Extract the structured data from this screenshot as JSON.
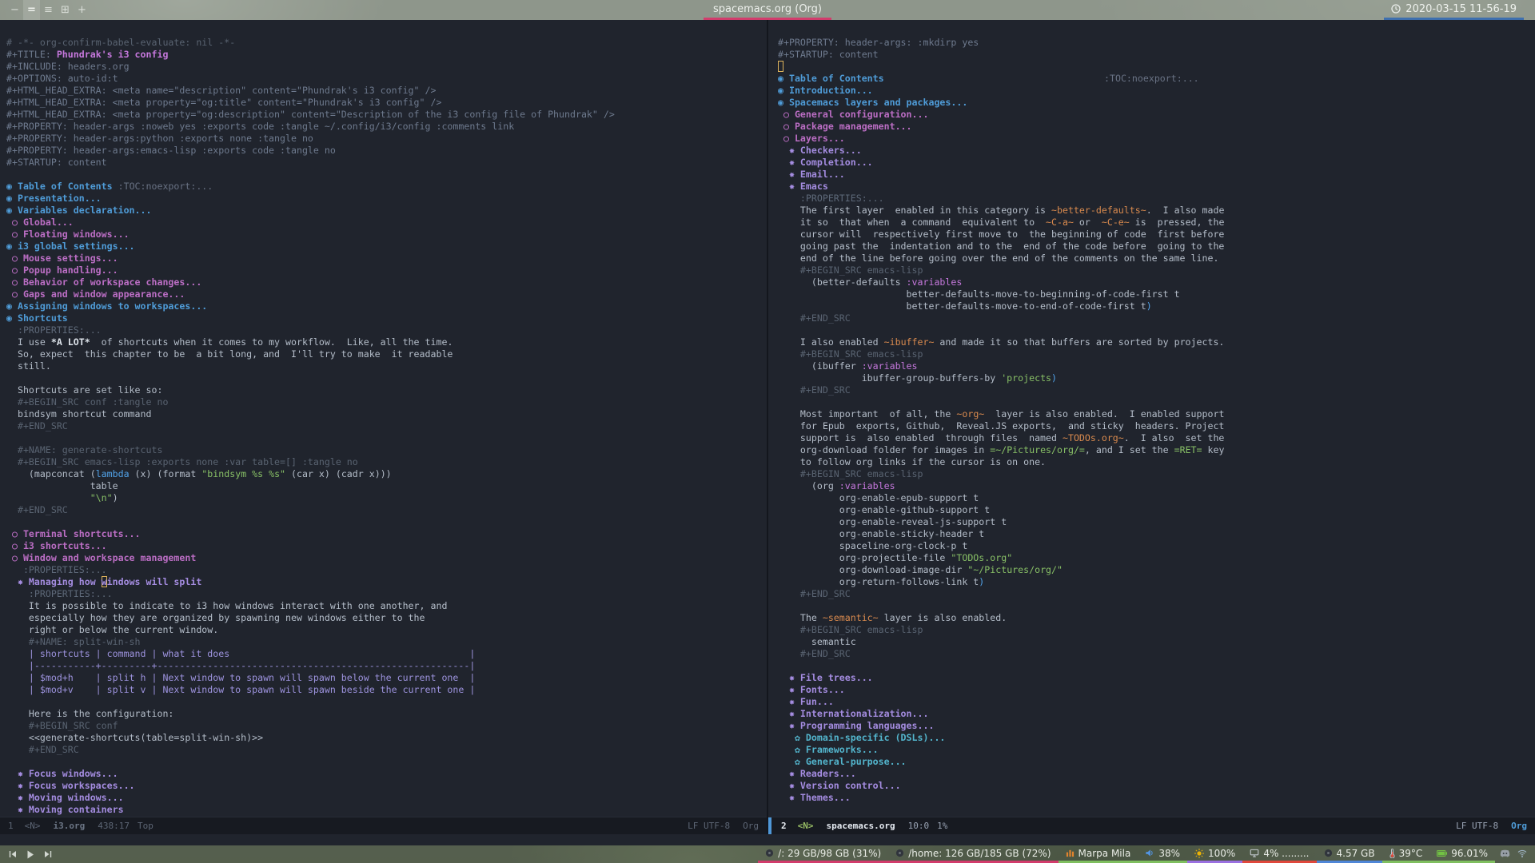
{
  "topbar": {
    "workspaces": [
      {
        "glyph": "−",
        "active": false
      },
      {
        "glyph": "=",
        "active": true
      },
      {
        "glyph": "≡",
        "active": false
      },
      {
        "glyph": "⊞",
        "active": false
      },
      {
        "glyph": "+",
        "active": false
      }
    ],
    "window_title": "spacemacs.org (Org)",
    "title_underline": "#d23c6c",
    "clock": "2020-03-15 11-56-19",
    "clock_underline": "#3e6fae"
  },
  "left_window": {
    "lines": [
      [
        [
          "cm",
          "# -*- org-confirm-babel-evaluate: nil -*-"
        ]
      ],
      [
        [
          "m",
          "#+TITLE: "
        ],
        [
          "title",
          "Phundrak's i3 config"
        ]
      ],
      [
        [
          "m",
          "#+INCLUDE: headers.org"
        ]
      ],
      [
        [
          "m",
          "#+OPTIONS: auto-id:t"
        ]
      ],
      [
        [
          "m",
          "#+HTML_HEAD_EXTRA: <meta name=\"description\" content=\"Phundrak's i3 config\" />"
        ]
      ],
      [
        [
          "m",
          "#+HTML_HEAD_EXTRA: <meta property=\"og:title\" content=\"Phundrak's i3 config\" />"
        ]
      ],
      [
        [
          "m",
          "#+HTML_HEAD_EXTRA: <meta property=\"og:description\" content=\"Description of the i3 config file of Phundrak\" />"
        ]
      ],
      [
        [
          "m",
          "#+PROPERTY: header-args :noweb yes :exports code :tangle ~/.config/i3/config :comments link"
        ]
      ],
      [
        [
          "m",
          "#+PROPERTY: header-args:python :exports none :tangle no"
        ]
      ],
      [
        [
          "m",
          "#+PROPERTY: header-args:emacs-lisp :exports code :tangle no"
        ]
      ],
      [
        [
          "m",
          "#+STARTUP: content"
        ]
      ],
      [],
      [
        [
          "h1",
          "◉ Table of Contents "
        ],
        [
          "tag",
          ":TOC:noexport:..."
        ]
      ],
      [
        [
          "h1",
          "◉ Presentation..."
        ]
      ],
      [
        [
          "h1",
          "◉ Variables declaration..."
        ]
      ],
      [
        [
          "h2",
          " ○ Global..."
        ]
      ],
      [
        [
          "h2",
          " ○ Floating windows..."
        ]
      ],
      [
        [
          "h1",
          "◉ i3 global settings..."
        ]
      ],
      [
        [
          "h2",
          " ○ Mouse settings..."
        ]
      ],
      [
        [
          "h2",
          " ○ Popup handling..."
        ]
      ],
      [
        [
          "h2",
          " ○ Behavior of workspace changes..."
        ]
      ],
      [
        [
          "h2",
          " ○ Gaps and window appearance..."
        ]
      ],
      [
        [
          "h1",
          "◉ Assigning windows to workspaces..."
        ]
      ],
      [
        [
          "h1",
          "◉ Shortcuts"
        ]
      ],
      [
        [
          "drw",
          "  :PROPERTIES:..."
        ]
      ],
      [
        [
          "t",
          "  I use "
        ],
        [
          "b",
          "*A LOT*"
        ],
        [
          "t",
          "  of shortcuts when it comes to my workflow.  Like, all the time."
        ]
      ],
      [
        [
          "t",
          "  So, expect  this chapter to be  a bit long, and  I'll try to make  it readable"
        ]
      ],
      [
        [
          "t",
          "  still."
        ]
      ],
      [],
      [
        [
          "t",
          "  Shortcuts are set like so:"
        ]
      ],
      [
        [
          "md",
          "  #+BEGIN_SRC conf :tangle no"
        ]
      ],
      [
        [
          "t",
          "  bindsym shortcut command"
        ]
      ],
      [
        [
          "md",
          "  #+END_SRC"
        ]
      ],
      [],
      [
        [
          "md",
          "  #+NAME: generate-shortcuts"
        ]
      ],
      [
        [
          "md",
          "  #+BEGIN_SRC emacs-lisp :exports none :var table=[] :tangle no"
        ]
      ],
      [
        [
          "t",
          "    (mapconcat ("
        ],
        [
          "fn",
          "lambda"
        ],
        [
          "t",
          " (x) (format "
        ],
        [
          "str",
          "\"bindsym %s %s\""
        ],
        [
          "t",
          " (car x) (cadr x)))"
        ]
      ],
      [
        [
          "t",
          "               table"
        ]
      ],
      [
        [
          "t",
          "               "
        ],
        [
          "str",
          "\"\\n\""
        ],
        [
          "t",
          ")"
        ]
      ],
      [
        [
          "md",
          "  #+END_SRC"
        ]
      ],
      [],
      [
        [
          "h2",
          " ○ Terminal shortcuts..."
        ]
      ],
      [
        [
          "h2",
          " ○ i3 shortcuts..."
        ]
      ],
      [
        [
          "h2",
          " ○ Window and workspace management"
        ]
      ],
      [
        [
          "drw",
          "   :PROPERTIES:..."
        ]
      ],
      [
        [
          "h3",
          "  ✸ Managing how "
        ],
        [
          "h3 cur",
          "w"
        ],
        [
          "h3",
          "indows will split"
        ]
      ],
      [
        [
          "drw",
          "    :PROPERTIES:..."
        ]
      ],
      [
        [
          "t",
          "    It is possible to indicate to i3 how windows interact with one another, and"
        ]
      ],
      [
        [
          "t",
          "    especially how they are organized by spawning new windows either to the"
        ]
      ],
      [
        [
          "t",
          "    right or below the current window."
        ]
      ],
      [
        [
          "md",
          "    #+NAME: split-win-sh"
        ]
      ],
      [
        [
          "tbl",
          "    | shortcuts | command | what it does                                           |"
        ]
      ],
      [
        [
          "tbl",
          "    |-----------+---------+--------------------------------------------------------|"
        ]
      ],
      [
        [
          "tbl",
          "    | $mod+h    | split h | Next window to spawn will spawn below the current one  |"
        ]
      ],
      [
        [
          "tbl",
          "    | $mod+v    | split v | Next window to spawn will spawn beside the current one |"
        ]
      ],
      [],
      [
        [
          "t",
          "    Here is the configuration:"
        ]
      ],
      [
        [
          "md",
          "    #+BEGIN_SRC conf"
        ]
      ],
      [
        [
          "t",
          "    <<generate-shortcuts(table=split-win-sh)>>"
        ]
      ],
      [
        [
          "md",
          "    #+END_SRC"
        ]
      ],
      [],
      [
        [
          "h3",
          "  ✸ Focus windows..."
        ]
      ],
      [
        [
          "h3",
          "  ✸ Focus workspaces..."
        ]
      ],
      [
        [
          "h3",
          "  ✸ Moving windows..."
        ]
      ],
      [
        [
          "h3",
          "  ✸ Moving containers"
        ]
      ]
    ],
    "modeline": {
      "window_number": "1",
      "state": "<N>",
      "buffer": "i3.org",
      "position": "438:17",
      "scroll": "Top",
      "encoding": "LF UTF-8",
      "mode": "Org"
    }
  },
  "right_window": {
    "lines": [
      [
        [
          "m",
          "#+PROPERTY: header-args: :mkdirp yes"
        ]
      ],
      [
        [
          "m",
          "#+STARTUP: content"
        ]
      ],
      [
        [
          "cur",
          " "
        ]
      ],
      [
        [
          "h1",
          "◉ Table of Contents"
        ],
        [
          "tagr",
          ":TOC:noexport:..."
        ]
      ],
      [
        [
          "h1",
          "◉ Introduction..."
        ]
      ],
      [
        [
          "h1",
          "◉ Spacemacs layers and packages..."
        ]
      ],
      [
        [
          "h2",
          " ○ General configuration..."
        ]
      ],
      [
        [
          "h2",
          " ○ Package management..."
        ]
      ],
      [
        [
          "h2",
          " ○ Layers..."
        ]
      ],
      [
        [
          "h3",
          "  ✸ Checkers..."
        ]
      ],
      [
        [
          "h3",
          "  ✸ Completion..."
        ]
      ],
      [
        [
          "h3",
          "  ✸ Email..."
        ]
      ],
      [
        [
          "h3",
          "  ✸ Emacs"
        ]
      ],
      [
        [
          "drw",
          "    :PROPERTIES:..."
        ]
      ],
      [
        [
          "t",
          "    The first layer  enabled in this category is "
        ],
        [
          "code",
          "~better-defaults~"
        ],
        [
          "t",
          ".  I also made"
        ]
      ],
      [
        [
          "t",
          "    it so  that when  a command  equivalent to  "
        ],
        [
          "code",
          "~C-a~"
        ],
        [
          "t",
          " or  "
        ],
        [
          "code",
          "~C-e~"
        ],
        [
          "t",
          " is  pressed, the"
        ]
      ],
      [
        [
          "t",
          "    cursor will  respectively first move to  the beginning of code  first before"
        ]
      ],
      [
        [
          "t",
          "    going past the  indentation and to the  end of the code before  going to the"
        ]
      ],
      [
        [
          "t",
          "    end of the line before going over the end of the comments on the same line."
        ]
      ],
      [
        [
          "md",
          "    #+BEGIN_SRC emacs-lisp"
        ]
      ],
      [
        [
          "t",
          "      (better-defaults "
        ],
        [
          "kw",
          ":variables"
        ]
      ],
      [
        [
          "t",
          "                       better-defaults-move-to-beginning-of-code-first t"
        ]
      ],
      [
        [
          "t",
          "                       better-defaults-move-to-end-of-code-first t"
        ],
        [
          "pb",
          ")"
        ]
      ],
      [
        [
          "md",
          "    #+END_SRC"
        ]
      ],
      [],
      [
        [
          "t",
          "    I also enabled "
        ],
        [
          "code",
          "~ibuffer~"
        ],
        [
          "t",
          " and made it so that buffers are sorted by projects."
        ]
      ],
      [
        [
          "md",
          "    #+BEGIN_SRC emacs-lisp"
        ]
      ],
      [
        [
          "t",
          "      (ibuffer "
        ],
        [
          "kw",
          ":variables"
        ]
      ],
      [
        [
          "t",
          "               ibuffer-group-buffers-by "
        ],
        [
          "str",
          "'projects"
        ],
        [
          "pb",
          ")"
        ]
      ],
      [
        [
          "md",
          "    #+END_SRC"
        ]
      ],
      [],
      [
        [
          "t",
          "    Most important  of all, the "
        ],
        [
          "code",
          "~org~"
        ],
        [
          "t",
          "  layer is also enabled.  I enabled support"
        ]
      ],
      [
        [
          "t",
          "    for Epub  exports, Github,  Reveal.JS exports,  and sticky  headers. Project"
        ]
      ],
      [
        [
          "t",
          "    support is  also enabled  through files  named "
        ],
        [
          "code",
          "~TODOs.org~"
        ],
        [
          "t",
          ".  I also  set the"
        ]
      ],
      [
        [
          "t",
          "    org-download folder for images in "
        ],
        [
          "verb",
          "=~/Pictures/org/="
        ],
        [
          "t",
          ", and I set the "
        ],
        [
          "verb",
          "=RET="
        ],
        [
          "t",
          " key"
        ]
      ],
      [
        [
          "t",
          "    to follow org links if the cursor is on one."
        ]
      ],
      [
        [
          "md",
          "    #+BEGIN_SRC emacs-lisp"
        ]
      ],
      [
        [
          "t",
          "      (org "
        ],
        [
          "kw",
          ":variables"
        ]
      ],
      [
        [
          "t",
          "           org-enable-epub-support t"
        ]
      ],
      [
        [
          "t",
          "           org-enable-github-support t"
        ]
      ],
      [
        [
          "t",
          "           org-enable-reveal-js-support t"
        ]
      ],
      [
        [
          "t",
          "           org-enable-sticky-header t"
        ]
      ],
      [
        [
          "t",
          "           spaceline-org-clock-p t"
        ]
      ],
      [
        [
          "t",
          "           org-projectile-file "
        ],
        [
          "str",
          "\"TODOs.org\""
        ]
      ],
      [
        [
          "t",
          "           org-download-image-dir "
        ],
        [
          "str",
          "\"~/Pictures/org/\""
        ]
      ],
      [
        [
          "t",
          "           org-return-follows-link t"
        ],
        [
          "pb",
          ")"
        ]
      ],
      [
        [
          "md",
          "    #+END_SRC"
        ]
      ],
      [],
      [
        [
          "t",
          "    The "
        ],
        [
          "code",
          "~semantic~"
        ],
        [
          "t",
          " layer is also enabled."
        ]
      ],
      [
        [
          "md",
          "    #+BEGIN_SRC emacs-lisp"
        ]
      ],
      [
        [
          "t",
          "      semantic"
        ]
      ],
      [
        [
          "md",
          "    #+END_SRC"
        ]
      ],
      [],
      [
        [
          "h3",
          "  ✸ File trees..."
        ]
      ],
      [
        [
          "h3",
          "  ✸ Fonts..."
        ]
      ],
      [
        [
          "h3",
          "  ✸ Fun..."
        ]
      ],
      [
        [
          "h3",
          "  ✸ Internationalization..."
        ]
      ],
      [
        [
          "h3",
          "  ✸ Programming languages..."
        ]
      ],
      [
        [
          "h4",
          "   ✿ Domain-specific (DSLs)..."
        ]
      ],
      [
        [
          "h4",
          "   ✿ Frameworks..."
        ]
      ],
      [
        [
          "h4",
          "   ✿ General-purpose..."
        ]
      ],
      [
        [
          "h3",
          "  ✸ Readers..."
        ]
      ],
      [
        [
          "h3",
          "  ✸ Version control..."
        ]
      ],
      [
        [
          "h3",
          "  ✸ Themes..."
        ]
      ]
    ],
    "modeline": {
      "window_number": "2",
      "state": "<N>",
      "buffer": "spacemacs.org",
      "position": "10:0",
      "scroll": "1%",
      "encoding": "LF UTF-8",
      "mode": "Org"
    }
  },
  "polybar": {
    "media": [
      {
        "icon": "previous-icon",
        "interactable": true
      },
      {
        "icon": "play-icon",
        "interactable": true
      },
      {
        "icon": "next-icon",
        "interactable": true
      }
    ],
    "modules": [
      {
        "icon": "disk-icon",
        "label": "/: 29 GB/98 GB (31%)",
        "underline": "#d23c6c",
        "interactable": false
      },
      {
        "icon": "disk-icon",
        "label": "/home: 126 GB/185 GB (72%)",
        "underline": "#d23c6c",
        "interactable": false
      },
      {
        "icon": "music-icon",
        "label": "Marpa Mila",
        "underline": "#7fbf5f",
        "interactable": true
      },
      {
        "icon": "volume-icon",
        "label": "38%",
        "underline": "#7fbf5f",
        "interactable": true
      },
      {
        "icon": "brightness-icon",
        "label": "100%",
        "underline": "#9a70e0",
        "interactable": true
      },
      {
        "icon": "cpu-icon",
        "label": "4% .........",
        "underline": "#e0483c",
        "interactable": false
      },
      {
        "icon": "memory-icon",
        "label": "4.57 GB",
        "underline": "#4f86d7",
        "interactable": false
      },
      {
        "icon": "temperature-icon",
        "label": "39°C",
        "underline": "#7fbf5f",
        "interactable": false
      },
      {
        "icon": "battery-icon",
        "label": "96.01%",
        "underline": "#7fbf5f",
        "interactable": false
      }
    ],
    "tray": [
      "discord-icon",
      "network-icon"
    ]
  },
  "colors": {
    "emacs_background": "#20242d",
    "heading_level_1": "#4f9cd8",
    "heading_level_2": "#bc6ec5",
    "heading_level_3": "#a48ce0",
    "heading_level_4": "#53b5cd",
    "org_code": "#d98a4e",
    "org_verbatim": "#88c066",
    "cursor": "#e0b45c",
    "modeline_accent": "#4f97d7"
  }
}
